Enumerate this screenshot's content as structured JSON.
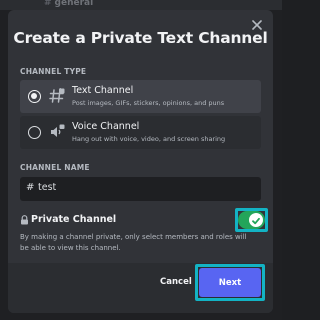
{
  "background": {
    "channel_name": "general"
  },
  "modal": {
    "title": "Create a Private Text Channel",
    "channel_type": {
      "label": "CHANNEL TYPE",
      "options": [
        {
          "title": "Text Channel",
          "description": "Post images, GIFs, stickers, opinions, and puns",
          "icon": "text-channel-icon",
          "selected": true
        },
        {
          "title": "Voice Channel",
          "description": "Hang out with voice, video, and screen sharing",
          "icon": "voice-channel-icon",
          "selected": false
        }
      ]
    },
    "channel_name": {
      "label": "CHANNEL NAME",
      "prefix": "#",
      "value": "test"
    },
    "private": {
      "label": "Private Channel",
      "enabled": true,
      "description": "By making a channel private, only select members and roles will be able to view this channel."
    },
    "footer": {
      "cancel_label": "Cancel",
      "next_label": "Next"
    }
  },
  "colors": {
    "accent": "#5865f2",
    "toggle_on": "#23a55a",
    "highlight": "#13b3c4"
  }
}
